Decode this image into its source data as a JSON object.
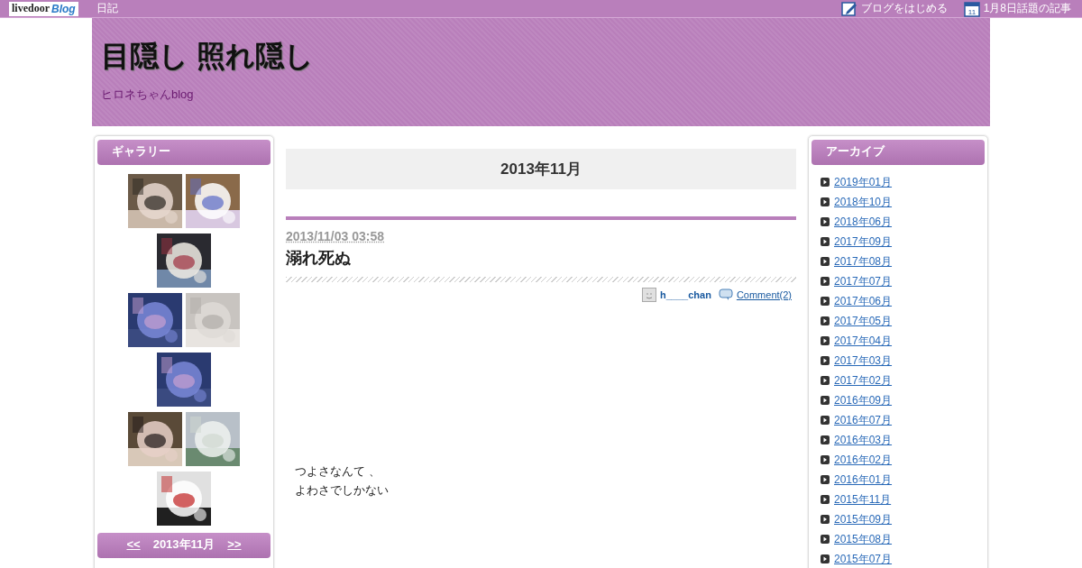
{
  "topbar": {
    "logo": "livedoor",
    "logo_blog": "Blog",
    "nav_link": "日記",
    "start_blog": "ブログをはじめる",
    "topics": "1月8日話題の記事",
    "calendar_day": "11"
  },
  "header": {
    "title": "目隠し 照れ隠し",
    "subtitle": "ヒロネちゃんblog"
  },
  "gallery": {
    "title": "ギャラリー"
  },
  "calendar": {
    "prev": "<<",
    "month": "2013年11月",
    "next": ">>"
  },
  "main": {
    "month_heading": "2013年11月",
    "post": {
      "date": "2013/11/03 03:58",
      "title": "溺れ死ぬ",
      "author": "h____chan",
      "comments": "Comment(2)",
      "body": [
        "つよさなんて 、",
        "よわさでしかない"
      ]
    }
  },
  "archive": {
    "title": "アーカイブ",
    "items": [
      "2019年01月",
      "2018年10月",
      "2018年06月",
      "2017年09月",
      "2017年08月",
      "2017年07月",
      "2017年06月",
      "2017年05月",
      "2017年04月",
      "2017年03月",
      "2017年02月",
      "2016年09月",
      "2016年07月",
      "2016年03月",
      "2016年02月",
      "2016年01月",
      "2015年11月",
      "2015年09月",
      "2015年08月",
      "2015年07月"
    ]
  }
}
